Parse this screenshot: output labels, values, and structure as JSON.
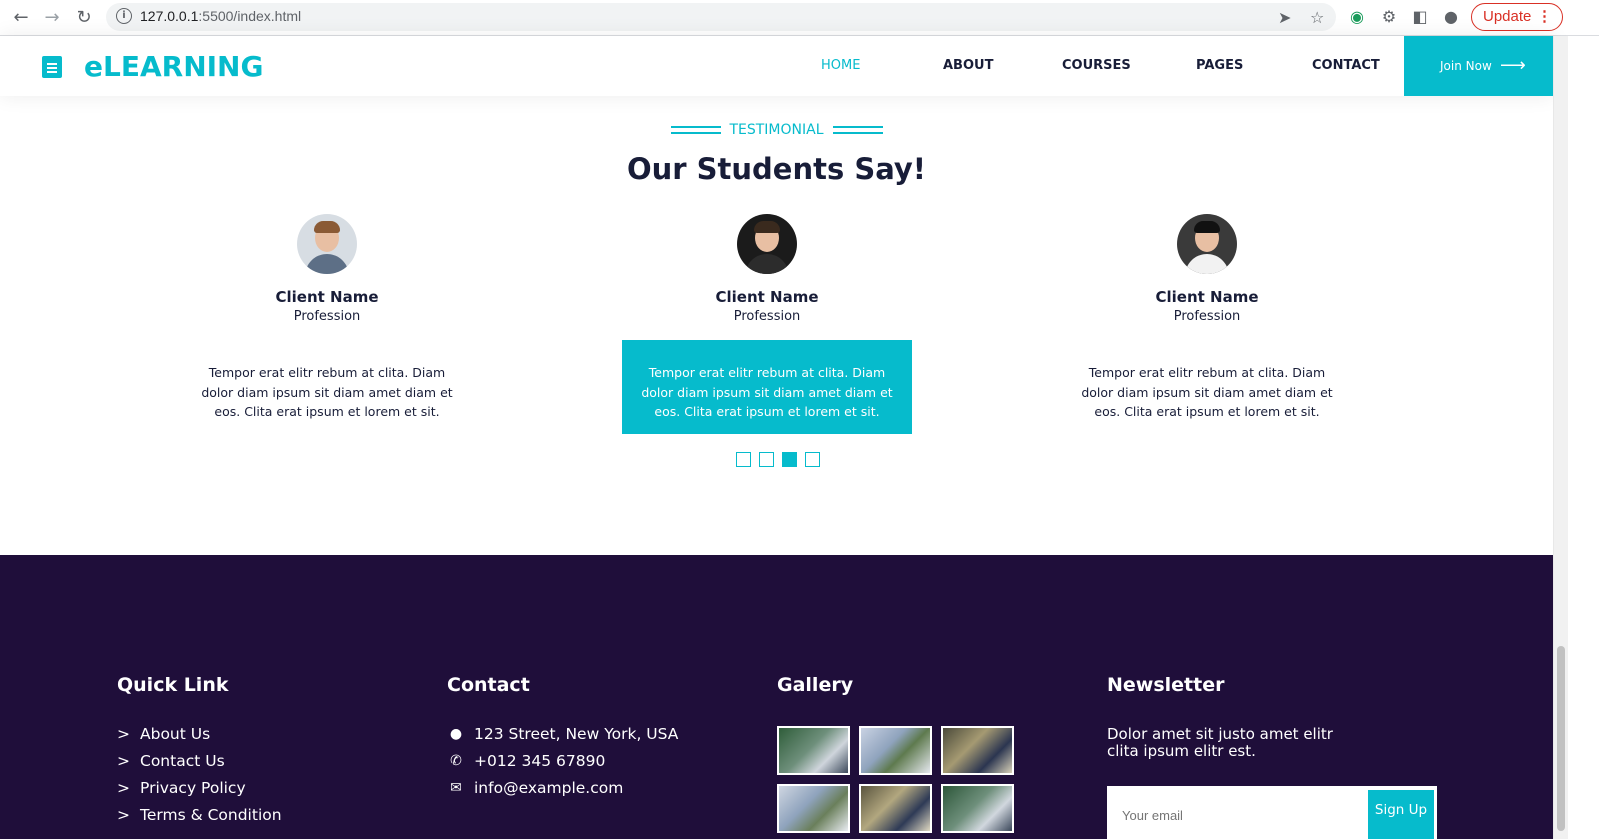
{
  "browser": {
    "url_host": "127.0.0.1",
    "url_rest": ":5500/index.html",
    "update_label": "Update"
  },
  "navbar": {
    "brand": "eLEARNING",
    "items": [
      {
        "label": "HOME",
        "active": true
      },
      {
        "label": "ABOUT",
        "active": false
      },
      {
        "label": "COURSES",
        "active": false
      },
      {
        "label": "PAGES",
        "active": false
      },
      {
        "label": "CONTACT",
        "active": false
      }
    ],
    "join_label": "Join Now"
  },
  "testimonial": {
    "tag": "TESTIMONIAL",
    "title": "Our Students Say!",
    "cards": [
      {
        "name": "Client Name",
        "profession": "Profession",
        "text": "Tempor erat elitr rebum at clita. Diam dolor diam ipsum sit diam amet diam et eos. Clita erat ipsum et lorem et sit."
      },
      {
        "name": "Client Name",
        "profession": "Profession",
        "text": "Tempor erat elitr rebum at clita. Diam dolor diam ipsum sit diam amet diam et eos. Clita erat ipsum et lorem et sit."
      },
      {
        "name": "Client Name",
        "profession": "Profession",
        "text": "Tempor erat elitr rebum at clita. Diam dolor diam ipsum sit diam amet diam et eos. Clita erat ipsum et lorem et sit."
      }
    ],
    "active_dot": 3,
    "dot_count": 4
  },
  "footer": {
    "quick_link_title": "Quick Link",
    "quick_links": [
      "About Us",
      "Contact Us",
      "Privacy Policy",
      "Terms & Condition"
    ],
    "contact_title": "Contact",
    "contact": [
      {
        "icon": "map-marker-icon",
        "text": "123 Street, New York, USA"
      },
      {
        "icon": "phone-icon",
        "text": "+012 345 67890"
      },
      {
        "icon": "envelope-icon",
        "text": "info@example.com"
      }
    ],
    "gallery_title": "Gallery",
    "newsletter_title": "Newsletter",
    "newsletter_text": "Dolor amet sit justo amet elitr clita ipsum elitr est.",
    "email_placeholder": "Your email",
    "signup_label": "Sign Up"
  },
  "colors": {
    "accent": "#06BBCC",
    "dark": "#181d38",
    "footer_bg": "#1f0e3a"
  }
}
